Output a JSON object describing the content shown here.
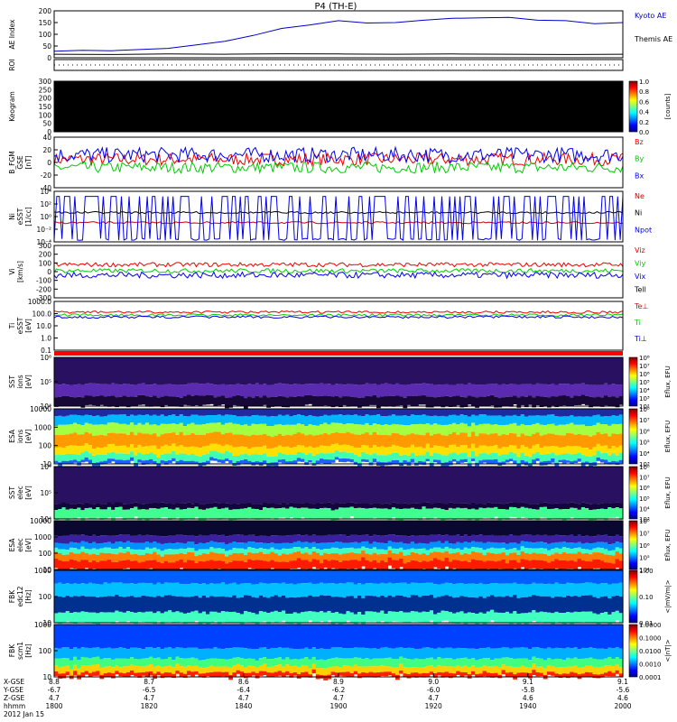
{
  "title": "P4 (TH-E)",
  "chart_data": [
    {
      "id": "ae",
      "type": "line",
      "ylabel": [
        "AE Index"
      ],
      "yticks": [
        "200",
        "150",
        "100",
        "50",
        "0"
      ],
      "ylim": [
        0,
        200
      ],
      "series": [
        {
          "name": "Kyoto AE",
          "color": "#0000cc",
          "x": [
            0,
            0.05,
            0.1,
            0.15,
            0.2,
            0.25,
            0.3,
            0.35,
            0.4,
            0.45,
            0.5,
            0.55,
            0.6,
            0.65,
            0.7,
            0.75,
            0.8,
            0.85,
            0.9,
            0.95,
            1.0
          ],
          "values": [
            28,
            32,
            30,
            35,
            40,
            55,
            70,
            95,
            125,
            140,
            158,
            148,
            150,
            160,
            168,
            170,
            172,
            160,
            158,
            145,
            150
          ]
        },
        {
          "name": "Themis AE",
          "color": "#000000",
          "x": [
            0,
            0.1,
            0.2,
            0.3,
            0.4,
            0.5,
            0.6,
            0.7,
            0.8,
            0.9,
            1.0
          ],
          "values": [
            15,
            14,
            16,
            15,
            17,
            16,
            15,
            16,
            15,
            14,
            15
          ]
        }
      ]
    },
    {
      "id": "roi",
      "type": "line",
      "ylabel": [
        "ROI"
      ],
      "yticks": [],
      "series": []
    },
    {
      "id": "keogram",
      "type": "heatmap",
      "ylabel": [
        "Keogram"
      ],
      "yticks": [
        "300",
        "250",
        "200",
        "150",
        "100",
        "50",
        "0"
      ],
      "colorbar": {
        "label": [
          "[counts]"
        ],
        "ticks": [
          "1.0",
          "0.8",
          "0.6",
          "0.4",
          "0.2",
          "0.0"
        ]
      }
    },
    {
      "id": "bfgm",
      "type": "line",
      "ylabel": [
        "B_FGM",
        "GSE",
        "[nT]"
      ],
      "yticks": [
        "40",
        "20",
        "0",
        "-20",
        "-40"
      ],
      "ylim": [
        -40,
        40
      ],
      "series": [
        {
          "name": "Bz",
          "color": "#ee0000",
          "mean": 5,
          "noise": 10
        },
        {
          "name": "By",
          "color": "#00cc00",
          "mean": -8,
          "noise": 9
        },
        {
          "name": "Bx",
          "color": "#0000ee",
          "mean": 12,
          "noise": 12
        }
      ]
    },
    {
      "id": "density",
      "type": "line",
      "ylabel": [
        "Ni",
        "eSST",
        "[1/cc]"
      ],
      "yticks": [
        "10⁴",
        "10²",
        "10⁰",
        "10⁻²",
        "10⁻⁴"
      ],
      "series": [
        {
          "name": "Ne",
          "color": "#cc0000"
        },
        {
          "name": "Ni",
          "color": "#000000"
        },
        {
          "name": "Npot",
          "color": "#0000ee"
        }
      ]
    },
    {
      "id": "velocity",
      "type": "line",
      "ylabel": [
        "Vi",
        "[km/s]"
      ],
      "yticks": [
        "300",
        "200",
        "100",
        "0",
        "-100",
        "-200",
        "-300"
      ],
      "ylim": [
        -300,
        300
      ],
      "series": [
        {
          "name": "Viz",
          "color": "#ee0000",
          "mean": 80,
          "noise": 25
        },
        {
          "name": "Viy",
          "color": "#00cc00",
          "mean": 10,
          "noise": 25
        },
        {
          "name": "Vix",
          "color": "#0000ee",
          "mean": -40,
          "noise": 35
        },
        {
          "name": "Tell",
          "color": "#000000"
        }
      ]
    },
    {
      "id": "temperature",
      "type": "line",
      "ylabel": [
        "Ti",
        "eSST",
        "[eV]"
      ],
      "yticks": [
        "1000.0",
        "100.0",
        "10.0",
        "1.0",
        "0.1"
      ],
      "series": [
        {
          "name": "Te⊥",
          "color": "#ee0000"
        },
        {
          "name": "Ti",
          "color": "#00cc00"
        },
        {
          "name": "Ti⊥",
          "color": "#0000ee"
        }
      ]
    },
    {
      "id": "sst-ion",
      "type": "heatmap",
      "ylabel": [
        "SST",
        "ions",
        "[eV]"
      ],
      "yticks": [
        "10⁶",
        "10⁵",
        "10⁴"
      ],
      "colorbar": {
        "label": [
          "Eflux, EFU"
        ],
        "ticks": [
          "10⁸",
          "10⁷",
          "10⁶",
          "10⁵",
          "10⁴",
          "10³",
          "10²"
        ]
      }
    },
    {
      "id": "esa-ion",
      "type": "heatmap",
      "ylabel": [
        "ESA",
        "ions",
        "[eV]"
      ],
      "yticks": [
        "10000",
        "1000",
        "100",
        "10"
      ],
      "colorbar": {
        "label": [
          "Eflux, EFU"
        ],
        "ticks": [
          "10⁸",
          "10⁷",
          "10⁶",
          "10⁵",
          "10⁴",
          "10³"
        ]
      }
    },
    {
      "id": "sst-elec",
      "type": "heatmap",
      "ylabel": [
        "SST",
        "elec",
        "[eV]"
      ],
      "yticks": [
        "10⁶",
        "10⁵",
        "10⁴"
      ],
      "colorbar": {
        "label": [
          "Eflux, EFU"
        ],
        "ticks": [
          "10⁸",
          "10⁷",
          "10⁶",
          "10⁵",
          "10⁴",
          "10³"
        ]
      }
    },
    {
      "id": "esa-elec",
      "type": "heatmap",
      "ylabel": [
        "ESA",
        "elec",
        "[eV]"
      ],
      "yticks": [
        "10000",
        "1000",
        "100",
        "10"
      ],
      "colorbar": {
        "label": [
          "Eflux, EFU"
        ],
        "ticks": [
          "10⁸",
          "10⁷",
          "10⁶",
          "10⁵",
          "10⁴"
        ]
      }
    },
    {
      "id": "fbk-edc",
      "type": "heatmap",
      "ylabel": [
        "FBK",
        "edc12",
        "[Hz]"
      ],
      "yticks": [
        "1000",
        "100",
        "10"
      ],
      "colorbar": {
        "label": [
          "<|mV/m|>"
        ],
        "ticks": [
          "1.00",
          "0.10",
          "0.01"
        ]
      }
    },
    {
      "id": "fbk-scm",
      "type": "heatmap",
      "ylabel": [
        "FBK",
        "scm1",
        "[Hz]"
      ],
      "yticks": [
        "1000",
        "100",
        "10"
      ],
      "colorbar": {
        "label": [
          "<|nT|>"
        ],
        "ticks": [
          "1.0000",
          "0.1000",
          "0.0100",
          "0.0010",
          "0.0001"
        ]
      }
    }
  ],
  "xaxis": {
    "row_labels": [
      "X-GSE",
      "Y-GSE",
      "Z-GSE",
      "hhmm",
      "2012 Jan 15"
    ],
    "ticks": [
      {
        "x": 0.0,
        "values": [
          "8.8",
          "-6.7",
          "4.7",
          "1800"
        ]
      },
      {
        "x": 0.167,
        "values": [
          "8.7",
          "-6.5",
          "4.7",
          "1820"
        ]
      },
      {
        "x": 0.333,
        "values": [
          "8.6",
          "-6.4",
          "4.7",
          "1840"
        ]
      },
      {
        "x": 0.5,
        "values": [
          "8.9",
          "-6.2",
          "4.7",
          "1900"
        ]
      },
      {
        "x": 0.667,
        "values": [
          "9.0",
          "-6.0",
          "4.7",
          "1920"
        ]
      },
      {
        "x": 0.833,
        "values": [
          "9.1",
          "-5.8",
          "4.6",
          "1940"
        ]
      },
      {
        "x": 1.0,
        "values": [
          "9.1",
          "-5.6",
          "4.6",
          "2000"
        ]
      }
    ]
  }
}
